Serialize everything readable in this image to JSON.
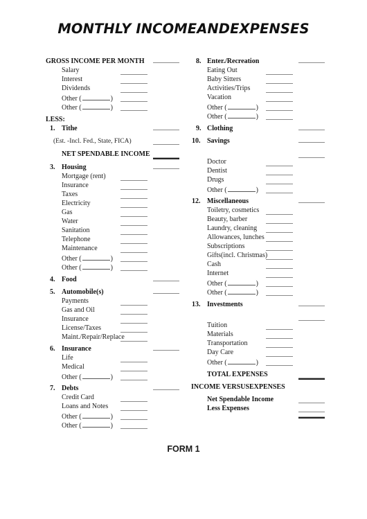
{
  "title": "MONTHLY INCOMEANDEXPENSES",
  "footer": "FORM 1",
  "left_column": [
    {
      "kind": "section",
      "label": "GROSS INCOME PER MONTH",
      "total_line": "single"
    },
    {
      "kind": "item",
      "label": "Salary"
    },
    {
      "kind": "item",
      "label": "Interest"
    },
    {
      "kind": "item",
      "label": "Dividends"
    },
    {
      "kind": "other",
      "label": "Other (",
      "suffix": ")"
    },
    {
      "kind": "other",
      "label": "Other (",
      "suffix": ")"
    },
    {
      "kind": "section",
      "label": "LESS:"
    },
    {
      "kind": "category",
      "number": "1.",
      "label": "Tithe",
      "total_line": "single"
    },
    {
      "kind": "note",
      "label": "(Est. -Incl. Fed., State, FICA)",
      "total_line": "single"
    },
    {
      "kind": "subtotal",
      "label": "NET SPENDABLE INCOME",
      "total_line": "double"
    },
    {
      "kind": "category",
      "number": "3.",
      "label": "Housing",
      "total_line": "single"
    },
    {
      "kind": "item",
      "label": "Mortgage (rent)"
    },
    {
      "kind": "item",
      "label": "Insurance"
    },
    {
      "kind": "item",
      "label": "Taxes"
    },
    {
      "kind": "item",
      "label": "Electricity"
    },
    {
      "kind": "item",
      "label": "Gas"
    },
    {
      "kind": "item",
      "label": "Water"
    },
    {
      "kind": "item",
      "label": "Sanitation"
    },
    {
      "kind": "item",
      "label": "Telephone"
    },
    {
      "kind": "item",
      "label": "Maintenance"
    },
    {
      "kind": "other",
      "label": "Other (",
      "suffix": ")"
    },
    {
      "kind": "other",
      "label": "Other (",
      "suffix": ")"
    },
    {
      "kind": "category",
      "number": "4.",
      "label": "Food",
      "total_line": "single"
    },
    {
      "kind": "category",
      "number": "5.",
      "label": "Automobile(s)",
      "total_line": "single"
    },
    {
      "kind": "item",
      "label": "Payments"
    },
    {
      "kind": "item",
      "label": "Gas and Oil"
    },
    {
      "kind": "item",
      "label": "Insurance"
    },
    {
      "kind": "item",
      "label": "License/Taxes"
    },
    {
      "kind": "item",
      "label": "Maint./Repair/Replace"
    },
    {
      "kind": "category",
      "number": "6.",
      "label": "Insurance",
      "total_line": "single"
    },
    {
      "kind": "item",
      "label": "Life"
    },
    {
      "kind": "item",
      "label": "Medical"
    },
    {
      "kind": "other",
      "label": "Other (",
      "suffix": ")"
    },
    {
      "kind": "category",
      "number": "7.",
      "label": "Debts",
      "total_line": "single"
    },
    {
      "kind": "item",
      "label": "Credit Card"
    },
    {
      "kind": "item",
      "label": "Loans and Notes"
    },
    {
      "kind": "other",
      "label": "Other (",
      "suffix": ")"
    },
    {
      "kind": "other",
      "label": "Other (",
      "suffix": ")"
    }
  ],
  "right_column": [
    {
      "kind": "category",
      "number": "8.",
      "label": "Enter./Recreation",
      "total_line": "single"
    },
    {
      "kind": "item",
      "label": "Eating Out"
    },
    {
      "kind": "item",
      "label": "Baby Sitters"
    },
    {
      "kind": "item",
      "label": "Activities/Trips"
    },
    {
      "kind": "item",
      "label": "Vacation"
    },
    {
      "kind": "other",
      "label": "Other (",
      "suffix": ")"
    },
    {
      "kind": "other",
      "label": "Other (",
      "suffix": ")"
    },
    {
      "kind": "category",
      "number": "9.",
      "label": "Clothing",
      "total_line": "single"
    },
    {
      "kind": "category",
      "number": "10.",
      "label": "Savings",
      "total_line": "single"
    },
    {
      "kind": "blank",
      "total_line": "single"
    },
    {
      "kind": "item",
      "label": "Doctor"
    },
    {
      "kind": "item",
      "label": "Dentist"
    },
    {
      "kind": "item",
      "label": "Drugs"
    },
    {
      "kind": "other",
      "label": "Other (",
      "suffix": ")"
    },
    {
      "kind": "category",
      "number": "12.",
      "label": "Miscellaneous",
      "total_line": "single"
    },
    {
      "kind": "item",
      "label": "Toiletry, cosmetics"
    },
    {
      "kind": "item",
      "label": "Beauty, barber"
    },
    {
      "kind": "item",
      "label": "Laundry, cleaning"
    },
    {
      "kind": "item",
      "label": "Allowances, lunches"
    },
    {
      "kind": "item",
      "label": "Subscriptions"
    },
    {
      "kind": "item",
      "label": "Gifts(incl. Christmas)"
    },
    {
      "kind": "item",
      "label": "Cash"
    },
    {
      "kind": "item",
      "label": "Internet"
    },
    {
      "kind": "other",
      "label": "Other (",
      "suffix": ")"
    },
    {
      "kind": "other",
      "label": "Other (",
      "suffix": ")"
    },
    {
      "kind": "category",
      "number": "13.",
      "label": "Investments",
      "total_line": "single"
    },
    {
      "kind": "blank",
      "total_line": "single"
    },
    {
      "kind": "item",
      "label": "Tuition"
    },
    {
      "kind": "item",
      "label": "Materials"
    },
    {
      "kind": "item",
      "label": "Transportation"
    },
    {
      "kind": "item",
      "label": "Day Care"
    },
    {
      "kind": "other",
      "label": "Other (",
      "suffix": ")"
    },
    {
      "kind": "subtotal",
      "label": "TOTAL EXPENSES",
      "total_line": "double"
    },
    {
      "kind": "section",
      "label": "INCOME VERSUSEXPENSES"
    },
    {
      "kind": "summary",
      "label": "Net Spendable Income",
      "total_line": "single"
    },
    {
      "kind": "summary",
      "label": "Less Expenses",
      "total_line": "single"
    },
    {
      "kind": "blank",
      "total_line": "double"
    }
  ]
}
